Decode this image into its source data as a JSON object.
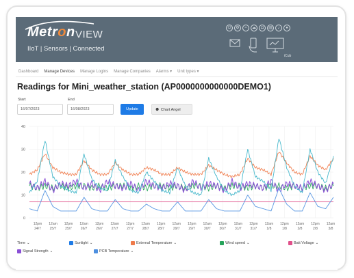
{
  "branding": {
    "logo_main": "Metr",
    "logo_o": "o",
    "logo_n": "n",
    "logo_view": "VIEW",
    "tagline": "IIoT | Sensors | Connected"
  },
  "header_icons": [
    "power-icon",
    "gear-icon",
    "wifi-icon",
    "cloud-icon",
    "lock-icon",
    "chart-icon",
    "bell-icon",
    "user-icon"
  ],
  "device_label": "iCub",
  "nav": {
    "items": [
      {
        "label": "Dashboard",
        "active": false
      },
      {
        "label": "Manage Devices",
        "active": true
      },
      {
        "label": "Manage Logins",
        "active": false
      },
      {
        "label": "Manage Companies",
        "active": false
      },
      {
        "label": "Alarms ▾",
        "active": false
      },
      {
        "label": "Unit types ▾",
        "active": false
      }
    ]
  },
  "page": {
    "title": "Readings for Mini_weather_station (AP0000000000000DEMO1)"
  },
  "form": {
    "start_label": "Start",
    "start_value": "16/07/2023",
    "end_label": "End",
    "end_value": "16/08/2023",
    "update_label": "Update",
    "chart_angel_label": "Chart Angel"
  },
  "colors": {
    "banner": "#5b6b78",
    "primary": "#1e7be6",
    "series_teal": "#3fb5c9",
    "series_orange": "#ef7a4a",
    "series_green": "#25a35a",
    "series_purple": "#8a4fd6",
    "series_pink": "#e0508a",
    "series_blue": "#4d8fe0"
  },
  "chart_data": {
    "type": "line",
    "y_tick_labels": [
      "40",
      "30",
      "20",
      "10",
      "0"
    ],
    "ylim": [
      0,
      40
    ],
    "x_tick_labels": [
      [
        "12pm",
        "24/7"
      ],
      [
        "12am",
        "25/7"
      ],
      [
        "12pm",
        "25/7"
      ],
      [
        "12am",
        "26/7"
      ],
      [
        "12pm",
        "26/7"
      ],
      [
        "12am",
        "27/7"
      ],
      [
        "12pm",
        "27/7"
      ],
      [
        "12am",
        "28/7"
      ],
      [
        "12pm",
        "28/7"
      ],
      [
        "12am",
        "29/7"
      ],
      [
        "12pm",
        "29/7"
      ],
      [
        "12am",
        "30/7"
      ],
      [
        "12pm",
        "30/7"
      ],
      [
        "12am",
        "31/7"
      ],
      [
        "12pm",
        "31/7"
      ],
      [
        "12am",
        "1/8"
      ],
      [
        "12pm",
        "1/8"
      ],
      [
        "12am",
        "2/8"
      ],
      [
        "12pm",
        "2/8"
      ],
      [
        "12am",
        "3/8"
      ]
    ],
    "grid": true,
    "series": [
      {
        "name": "Sunlight",
        "color": "#3fb5c9",
        "values": [
          11,
          16,
          34,
          18,
          14,
          12,
          11,
          28,
          17,
          13,
          12,
          25,
          18,
          12,
          11,
          20,
          16,
          12,
          11,
          22,
          14,
          11,
          10,
          26,
          18,
          12,
          10,
          12,
          30,
          18,
          16,
          12,
          35,
          22,
          14,
          11,
          30,
          20,
          15,
          27
        ]
      },
      {
        "name": "External Temperature",
        "color": "#ef7a4a",
        "values": [
          19,
          21,
          28,
          22,
          20,
          19,
          19,
          25,
          21,
          19,
          19,
          24,
          21,
          19,
          19,
          22,
          21,
          19,
          19,
          22,
          20,
          19,
          19,
          23,
          21,
          19,
          18,
          19,
          26,
          22,
          21,
          19,
          29,
          24,
          20,
          19,
          27,
          23,
          21,
          26
        ]
      },
      {
        "name": "Wind speed",
        "color": "#25a35a",
        "values": [
          14,
          13,
          14,
          13,
          14,
          13,
          14,
          14,
          13,
          14,
          13,
          14,
          14,
          13,
          14,
          13,
          14,
          14,
          13,
          14,
          13,
          14,
          14,
          13,
          14,
          13,
          14,
          14,
          13,
          14,
          13,
          14,
          14,
          13,
          14,
          13,
          14,
          14,
          13,
          14
        ]
      },
      {
        "name": "Batt Voltage",
        "color": "#e0508a",
        "values": [
          7,
          7,
          7,
          7,
          7,
          7,
          7,
          7,
          7,
          7,
          7,
          7,
          7,
          7,
          7,
          7,
          7,
          7,
          7,
          7,
          7,
          7,
          7,
          7,
          7,
          7,
          7,
          7,
          7,
          7,
          7,
          7,
          7,
          7,
          7,
          7,
          7,
          7,
          7,
          7
        ]
      },
      {
        "name": "Signal Strength",
        "color": "#8a4fd6",
        "values": [
          15,
          13,
          16,
          12,
          15,
          14,
          16,
          13,
          15,
          12,
          16,
          14,
          13,
          15,
          12,
          16,
          14,
          13,
          15,
          14,
          12,
          16,
          13,
          15,
          14,
          12,
          16,
          13,
          15,
          14,
          13,
          16,
          12,
          15,
          14,
          13,
          16,
          14,
          12,
          15
        ]
      },
      {
        "name": "PCB Temperature",
        "color": "#4d8fe0",
        "values": [
          4,
          3,
          12,
          5,
          3,
          3,
          3,
          9,
          4,
          3,
          3,
          8,
          4,
          3,
          3,
          6,
          4,
          3,
          3,
          7,
          3,
          3,
          3,
          8,
          4,
          3,
          3,
          3,
          10,
          5,
          4,
          3,
          13,
          6,
          3,
          3,
          11,
          5,
          4,
          9
        ]
      }
    ]
  },
  "legend": {
    "items": [
      {
        "label": "Time",
        "checked": false
      },
      {
        "label": "Sunlight",
        "checked": true
      },
      {
        "label": "External Temperature",
        "checked": true
      },
      {
        "label": "Wind speed",
        "checked": true
      },
      {
        "label": "Batt Voltage",
        "checked": true
      },
      {
        "label": "Signal Strength",
        "checked": true
      },
      {
        "label": "PCB Temperature",
        "checked": true
      }
    ]
  }
}
